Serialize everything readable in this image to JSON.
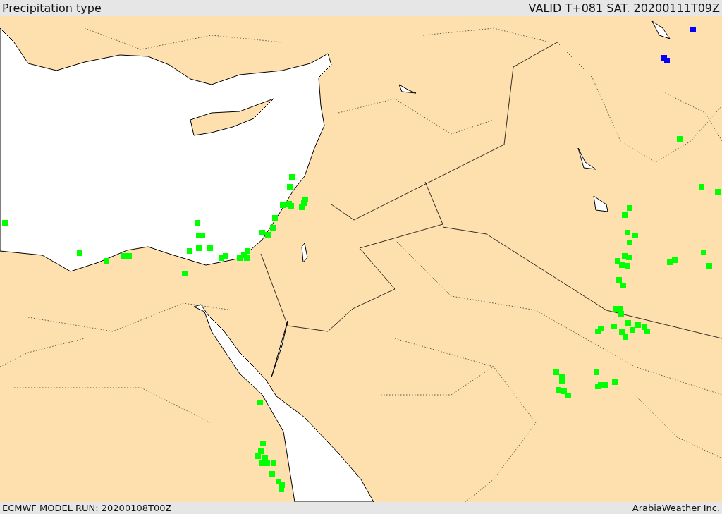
{
  "header": {
    "title": "Precipitation type",
    "valid_time": "VALID T+081 SAT. 20200111T09Z"
  },
  "footer": {
    "model_run": "ECMWF MODEL RUN: 20200108T00Z",
    "credit": "ArabiaWeather Inc."
  }
}
